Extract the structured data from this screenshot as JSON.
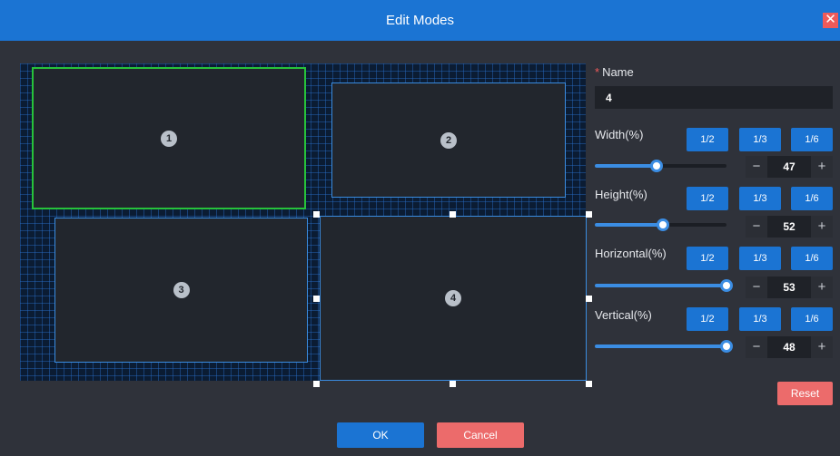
{
  "dialog": {
    "title": "Edit Modes",
    "close_icon": "close-icon"
  },
  "canvas": {
    "windows": [
      {
        "number": "1",
        "state": "active"
      },
      {
        "number": "2",
        "state": "normal"
      },
      {
        "number": "3",
        "state": "normal"
      },
      {
        "number": "4",
        "state": "selected"
      }
    ]
  },
  "form": {
    "name_required_mark": "*",
    "name_label": "Name",
    "name_value": "4",
    "fraction_buttons": [
      "1/2",
      "1/3",
      "1/6"
    ],
    "fields": [
      {
        "label": "Width(%)",
        "value": "47",
        "slider_fraction": 0.47
      },
      {
        "label": "Height(%)",
        "value": "52",
        "slider_fraction": 0.52
      },
      {
        "label": "Horizontal(%)",
        "value": "53",
        "slider_fraction": 1.0
      },
      {
        "label": "Vertical(%)",
        "value": "48",
        "slider_fraction": 1.0
      }
    ],
    "minus_symbol": "−",
    "plus_symbol": "+",
    "reset_label": "Reset"
  },
  "footer": {
    "ok_label": "OK",
    "cancel_label": "Cancel"
  },
  "colors": {
    "accent": "#1b74d3",
    "danger": "#ec6b6b",
    "active_window_border": "#27c23a",
    "window_border": "#3a8ce0"
  }
}
